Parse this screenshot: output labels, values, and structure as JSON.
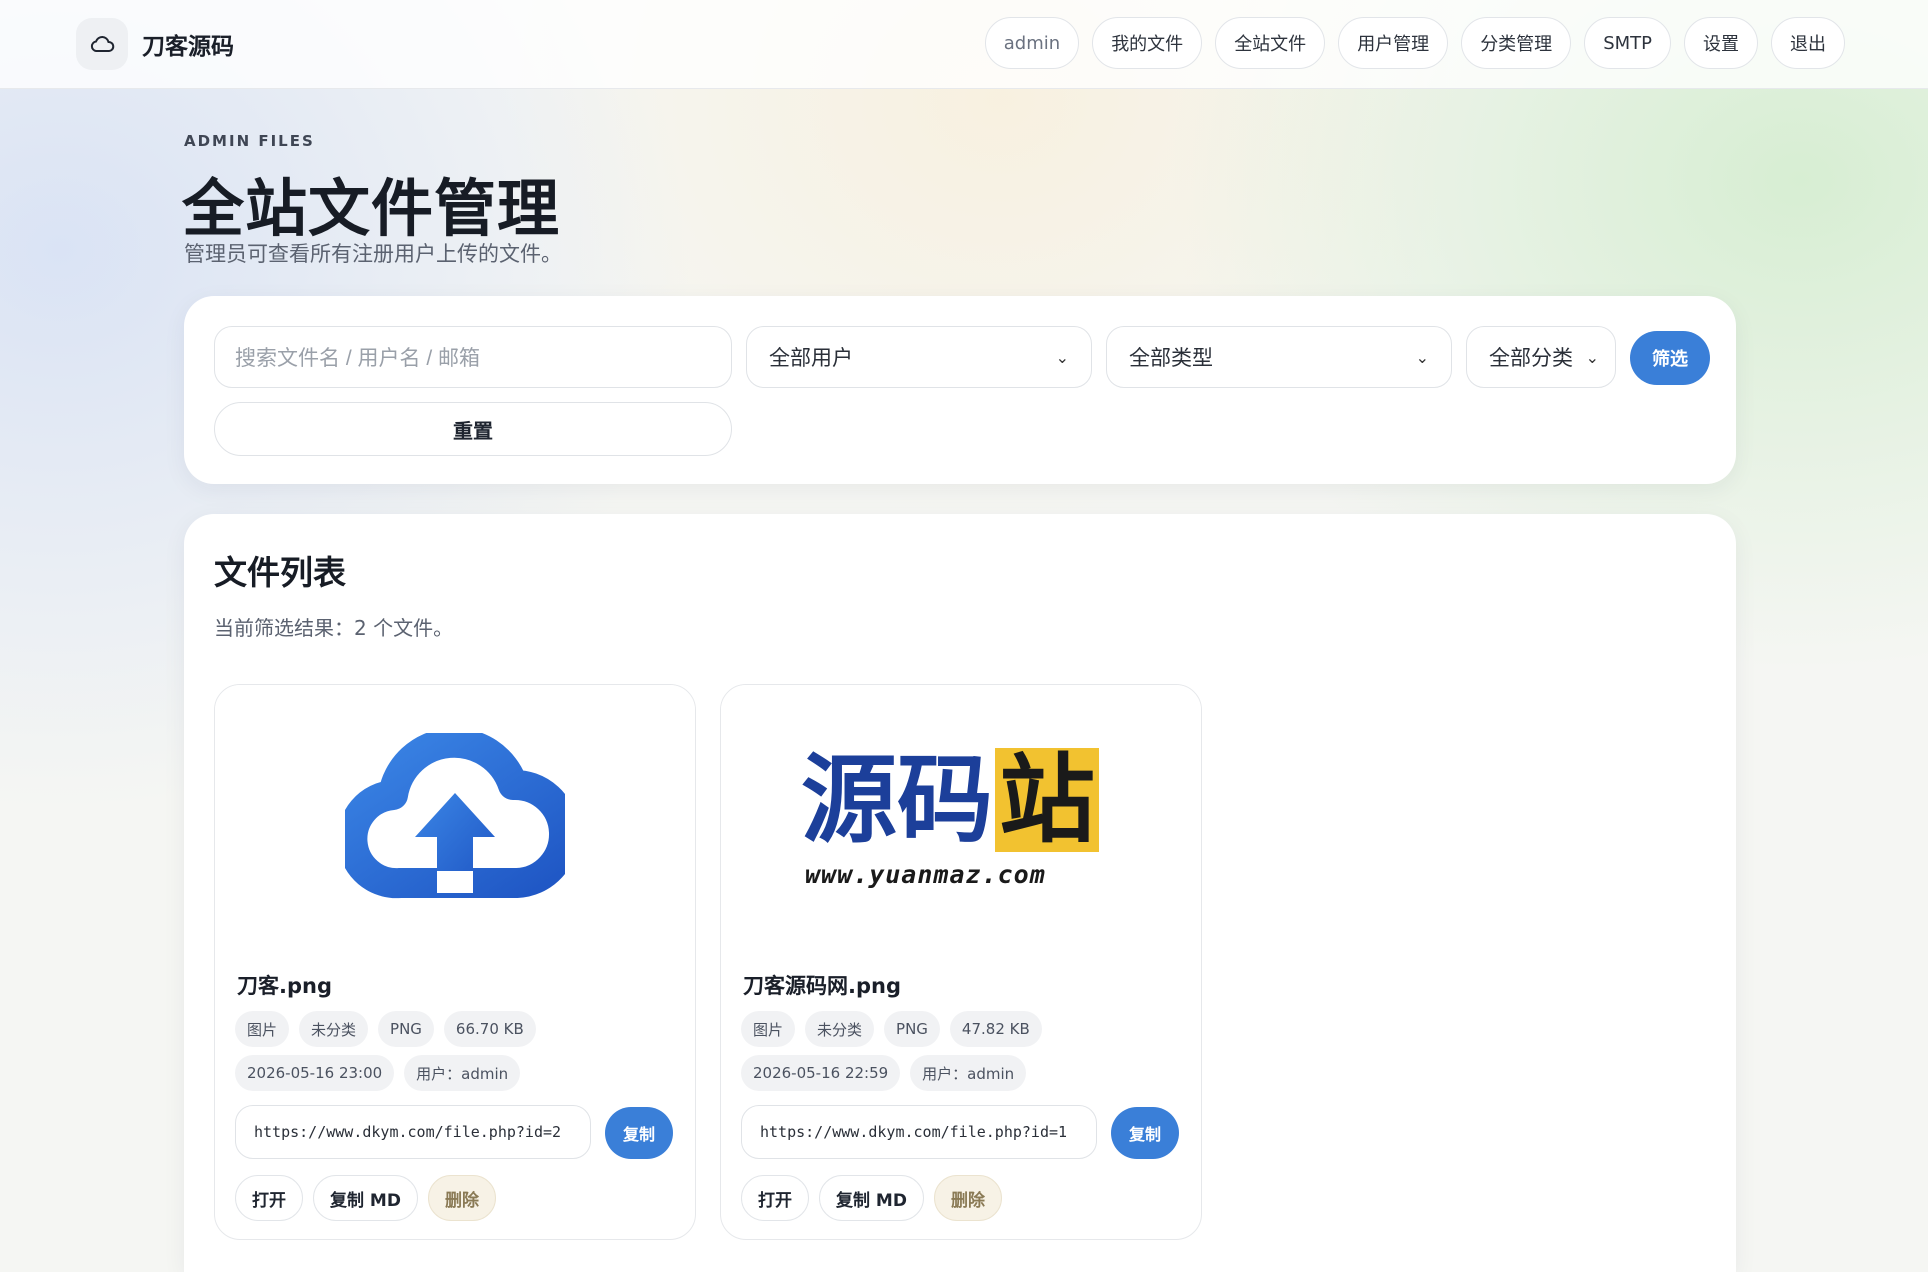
{
  "nav": {
    "brand": "刀客源码",
    "links": [
      "admin",
      "我的文件",
      "全站文件",
      "用户管理",
      "分类管理",
      "SMTP",
      "设置",
      "退出"
    ]
  },
  "header": {
    "eyebrow": "ADMIN FILES",
    "title": "全站文件管理",
    "desc": "管理员可查看所有注册用户上传的文件。"
  },
  "filter": {
    "search_placeholder": "搜索文件名 / 用户名 / 邮箱",
    "user_select": "全部用户",
    "type_select": "全部类型",
    "category_select": "全部分类",
    "submit_label": "筛选",
    "reset_label": "重置"
  },
  "list": {
    "title": "文件列表",
    "summary": "当前筛选结果：2 个文件。",
    "files": [
      {
        "name": "刀客.png",
        "tags": [
          "图片",
          "未分类",
          "PNG",
          "66.70 KB"
        ],
        "date": "2026-05-16 23:00",
        "user": "用户：admin",
        "url": "https://www.dkym.com/file.php?id=2",
        "thumb_icon": "cloud-upload-icon"
      },
      {
        "name": "刀客源码网.png",
        "tags": [
          "图片",
          "未分类",
          "PNG",
          "47.82 KB"
        ],
        "date": "2026-05-16 22:59",
        "user": "用户：admin",
        "url": "https://www.dkym.com/file.php?id=1",
        "thumb_logo": {
          "chars": [
            "源",
            "码",
            "站"
          ],
          "site": "www.yuanmaz.com"
        }
      }
    ],
    "copy_label": "复制",
    "open_label": "打开",
    "copy_md_label": "复制 MD",
    "delete_label": "删除"
  },
  "colors": {
    "accent": "#3a7fd8",
    "logo_blue": "#1c3f9a",
    "logo_yellow": "#f2c230"
  }
}
